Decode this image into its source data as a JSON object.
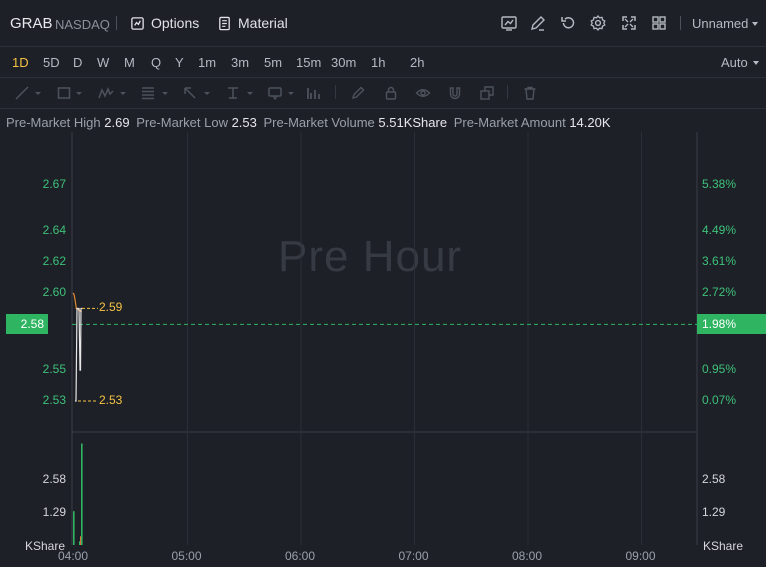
{
  "header": {
    "symbol": "GRAB",
    "exchange": "NASDAQ",
    "options_label": "Options",
    "material_label": "Material",
    "layout_name": "Unnamed",
    "icons": [
      "chart-icon",
      "edit-icon",
      "undo-icon",
      "gear-icon",
      "fullscreen-icon",
      "grid-icon"
    ]
  },
  "intervals": {
    "items": [
      "1D",
      "5D",
      "D",
      "W",
      "M",
      "Q",
      "Y",
      "1m",
      "3m",
      "5m",
      "15m",
      "30m",
      "1h",
      "2h"
    ],
    "active": "1D",
    "auto_label": "Auto"
  },
  "drawing_tools": [
    "line-tool-icon",
    "rectangle-tool-icon",
    "pattern-tool-icon",
    "fib-tool-icon",
    "arrow-tool-icon",
    "measure-tool-icon",
    "comment-tool-icon",
    "indicator-tool-icon",
    "pencil-icon",
    "lock-icon",
    "eye-icon",
    "magnet-icon",
    "clone-icon",
    "trash-icon"
  ],
  "info": {
    "high_label": "Pre-Market High",
    "high_value": "2.69",
    "low_label": "Pre-Market Low",
    "low_value": "2.53",
    "volume_label": "Pre-Market Volume",
    "volume_value": "5.51KShare",
    "amount_label": "Pre-Market Amount",
    "amount_value": "14.20K"
  },
  "chart_data": {
    "type": "line",
    "watermark": "Pre Hour",
    "x_ticks": [
      "04:00",
      "05:00",
      "06:00",
      "07:00",
      "08:00",
      "09:00"
    ],
    "price_ticks": [
      "2.67",
      "2.64",
      "2.62",
      "2.60",
      "2.55",
      "2.53"
    ],
    "price_tick_values": [
      2.67,
      2.64,
      2.62,
      2.6,
      2.55,
      2.53
    ],
    "percent_ticks": [
      "5.38%",
      "4.49%",
      "3.61%",
      "2.72%",
      "0.95%",
      "0.07%"
    ],
    "current_price": "2.58",
    "current_price_value": 2.58,
    "current_percent": "1.98%",
    "high_marker": "2.59",
    "low_marker": "2.53",
    "price_series": {
      "time": [
        "04:00",
        "04:00",
        "04:01",
        "04:02",
        "04:03",
        "04:04",
        "04:05",
        "04:06",
        "04:07"
      ],
      "avg_line": [
        2.6,
        2.599,
        2.595,
        2.59,
        2.59,
        2.589,
        2.589,
        2.588,
        2.588
      ],
      "price_line": [
        2.53,
        2.53,
        2.59,
        2.59,
        2.585,
        2.55,
        2.59,
        2.59,
        2.59
      ]
    },
    "volume_ticks": [
      "2.58",
      "1.29"
    ],
    "volume_ticks_right": [
      "2.58",
      "1.29"
    ],
    "volume_unit": "KShare",
    "volume_bars": [
      {
        "offset_min": 0,
        "value": 1.35,
        "color": "#2fb562"
      },
      {
        "offset_min": 6,
        "value": 0.15,
        "color": "#2fb562"
      },
      {
        "offset_min": 7,
        "value": 0.35,
        "color": "#e36a3a"
      },
      {
        "offset_min": 8,
        "value": 4.05,
        "color": "#2fb562"
      }
    ],
    "colors": {
      "up": "#2fb562",
      "down": "#e36a3a",
      "avg": "#e08a2f",
      "price": "#e6e6e6",
      "marker": "#f5c243"
    }
  }
}
